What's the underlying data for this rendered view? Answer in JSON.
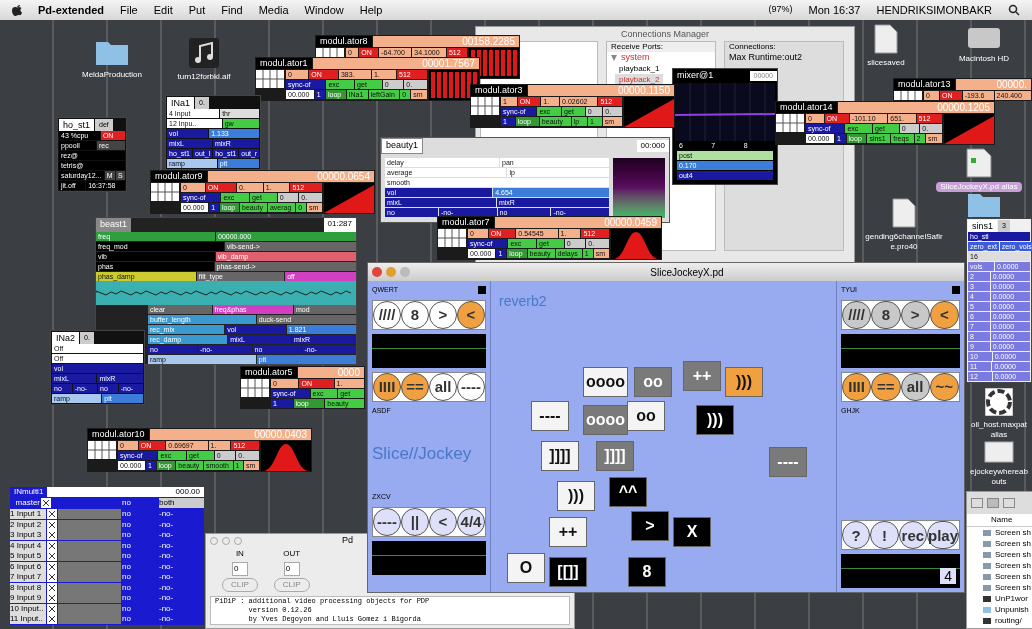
{
  "menubar": {
    "app": "Pd-extended",
    "menus": [
      "File",
      "Edit",
      "Put",
      "Find",
      "Media",
      "Window",
      "Help"
    ],
    "battery": "(97%)",
    "clock": "Mon 16:37",
    "user": "HENDRIKSIMONBAKR"
  },
  "desktop_icons": [
    {
      "kind": "folder",
      "label": "MeldaProduction"
    },
    {
      "kind": "music",
      "label": "turn12forbkl.aif"
    },
    {
      "kind": "file",
      "label": "slicesaved"
    },
    {
      "kind": "disk",
      "label": "Macintosh HD"
    },
    {
      "kind": "pd",
      "label": "SliceJockeyX.pd alias"
    },
    {
      "kind": "file",
      "label": "gending6channelSafire.pro40"
    },
    {
      "kind": "folder"
    },
    {
      "kind": "app",
      "label": "oll_host.maxpat alias"
    },
    {
      "kind": "screen",
      "label": "ejockeywhereabouts"
    }
  ],
  "connections_manager": {
    "title": "Connections Manager",
    "receive_label": "Receive Ports:",
    "tree": {
      "label": "system",
      "expanded": true,
      "children": [
        {
          "label": "playback_1",
          "selected": false
        },
        {
          "label": "playback_2",
          "selected": true
        }
      ]
    },
    "connections_label": "Connections:",
    "connections": [
      "Max Runtime:out2"
    ]
  },
  "patches": [
    {
      "kind": "beauty",
      "title": "beauty1",
      "value": "00:000",
      "lines": [
        [
          {
            "text": "delay",
            "color": "#ffffff"
          },
          {
            "text": "pan",
            "color": "#ffffff"
          }
        ],
        [
          {
            "text": "average",
            "color": "#ffffff"
          },
          {
            "text": "lp",
            "color": "#ffffff"
          }
        ],
        [
          {
            "text": "smooth",
            "color": "#ffffff"
          }
        ],
        [
          {
            "text": "vol",
            "color": "#1a1aa0"
          },
          {
            "text": "4.654",
            "color": "#3b7dd8"
          }
        ],
        [
          {
            "text": "mixL",
            "color": "#1a1aa0"
          },
          {
            "text": "mixR",
            "color": "#1a1aa0"
          }
        ],
        [
          {
            "text": "no",
            "color": "#1a1aa0"
          },
          {
            "text": "-no-",
            "color": "#1a1aa0"
          },
          {
            "text": "no",
            "color": "#1a1aa0"
          },
          {
            "text": "-no-",
            "color": "#1a1aa0"
          }
        ]
      ]
    },
    {
      "kind": "mixer",
      "title": "mixer@1",
      "value": "00000",
      "lines": [
        [
          {
            "text": "6",
            "color": "#000000"
          },
          {
            "text": "7",
            "color": "#000000"
          },
          {
            "text": "8",
            "color": "#000000"
          }
        ],
        [
          {
            "text": "post",
            "color": "#aee0a0"
          }
        ],
        [
          {
            "text": "0.170",
            "color": "#3b7dd8"
          }
        ],
        [
          {
            "text": "out4",
            "color": "#1a1aa0"
          }
        ]
      ]
    },
    {
      "kind": "modulator",
      "title": "modul.ator8",
      "value": "00158.2285",
      "graph": {
        "kind": "bars"
      },
      "lines": [
        [
          {
            "text": "0",
            "color": "#f4b08a"
          },
          {
            "text": "ON",
            "color": "#e02020"
          },
          {
            "text": "-64.700",
            "color": "#f4b08a"
          },
          {
            "text": "34.1000",
            "color": "#f4b08a"
          },
          {
            "text": "512",
            "color": "#e02020"
          }
        ]
      ]
    },
    {
      "kind": "modulator",
      "title": "modul.ator1",
      "value": "00001.7567",
      "graph": {
        "kind": "bars"
      },
      "lines": [
        [
          {
            "text": "0",
            "color": "#f4b08a"
          },
          {
            "text": "ON",
            "color": "#e02020"
          },
          {
            "text": "383.",
            "color": "#f4b08a"
          },
          {
            "text": "1.",
            "color": "#f4b08a"
          },
          {
            "text": "512",
            "color": "#e02020"
          }
        ],
        [
          {
            "text": "sync-of",
            "color": "#1a1aa0"
          },
          {
            "text": "exc",
            "color": "#44cc44"
          },
          {
            "text": "get",
            "color": "#44cc44"
          },
          {
            "text": "0",
            "color": "#cccccc"
          },
          {
            "text": "0.",
            "color": "#cccccc"
          }
        ],
        [
          {
            "text": "00.000",
            "color": "#ffffff"
          },
          {
            "text": "1",
            "color": "#1a1aa0"
          },
          {
            "text": "loop",
            "color": "#339933"
          },
          {
            "text": "INa1",
            "color": "#44cc44"
          },
          {
            "text": "leftGain",
            "color": "#44cc44"
          },
          {
            "text": "0",
            "color": "#44cc44"
          },
          {
            "text": "sm",
            "color": "#f4b08a"
          }
        ]
      ]
    },
    {
      "kind": "modulator",
      "title": "modul.ator3",
      "value": "00000.1150",
      "graph": {
        "kind": "ramp"
      },
      "lines": [
        [
          {
            "text": "1",
            "color": "#f4b08a"
          },
          {
            "text": "ON",
            "color": "#e02020"
          },
          {
            "text": "1.",
            "color": "#f4b08a"
          },
          {
            "text": "0.02602",
            "color": "#f4b08a"
          },
          {
            "text": "512",
            "color": "#e02020"
          }
        ],
        [
          {
            "text": "sync-of",
            "color": "#1a1aa0"
          },
          {
            "text": "exc",
            "color": "#44cc44"
          },
          {
            "text": "get",
            "color": "#44cc44"
          },
          {
            "text": "0",
            "color": "#cccccc"
          },
          {
            "text": "0.",
            "color": "#cccccc"
          }
        ],
        [
          {
            "text": "1",
            "color": "#1a1aa0"
          },
          {
            "text": "loop",
            "color": "#339933"
          },
          {
            "text": "beauty",
            "color": "#44cc44"
          },
          {
            "text": "lp",
            "color": "#44cc44"
          },
          {
            "text": "1",
            "color": "#44cc44"
          },
          {
            "text": "sm",
            "color": "#f4b08a"
          }
        ]
      ]
    },
    {
      "kind": "modulator",
      "title": "modul.ator13",
      "value": "00000.",
      "lines": [
        [
          {
            "text": "0",
            "color": "#f4b08a"
          },
          {
            "text": "ON",
            "color": "#e02020"
          },
          {
            "text": "-193.6",
            "color": "#f4b08a"
          },
          {
            "text": "240.400",
            "color": "#f4b08a"
          }
        ]
      ]
    },
    {
      "kind": "modulator",
      "title": "modul.ator14",
      "value": "00000.1205",
      "graph": {
        "kind": "ramp"
      },
      "lines": [
        [
          {
            "text": "0",
            "color": "#f4b08a"
          },
          {
            "text": "ON",
            "color": "#e02020"
          },
          {
            "text": "-101.10",
            "color": "#f4b08a"
          },
          {
            "text": "651.",
            "color": "#f4b08a"
          },
          {
            "text": "512",
            "color": "#e02020"
          }
        ],
        [
          {
            "text": "sync-of",
            "color": "#1a1aa0"
          },
          {
            "text": "exc",
            "color": "#44cc44"
          },
          {
            "text": "get",
            "color": "#44cc44"
          },
          {
            "text": "0",
            "color": "#cccccc"
          },
          {
            "text": "0.",
            "color": "#cccccc"
          }
        ],
        [
          {
            "text": "00.000",
            "color": "#ffffff"
          },
          {
            "text": "1",
            "color": "#1a1aa0"
          },
          {
            "text": "loop",
            "color": "#339933"
          },
          {
            "text": "sins1",
            "color": "#44cc44"
          },
          {
            "text": "freqs",
            "color": "#44cc44"
          },
          {
            "text": "2",
            "color": "#44cc44"
          },
          {
            "text": "sm",
            "color": "#f4b08a"
          }
        ]
      ]
    },
    {
      "kind": "modulator",
      "title": "modul.ator9",
      "value": "00000.0654",
      "graph": {
        "kind": "ramp"
      },
      "lines": [
        [
          {
            "text": "0",
            "color": "#f4b08a"
          },
          {
            "text": "ON",
            "color": "#e02020"
          },
          {
            "text": "0.",
            "color": "#f4b08a"
          },
          {
            "text": "1.",
            "color": "#f4b08a"
          },
          {
            "text": "512",
            "color": "#e02020"
          }
        ],
        [
          {
            "text": "sync-of",
            "color": "#1a1aa0"
          },
          {
            "text": "exc",
            "color": "#44cc44"
          },
          {
            "text": "get",
            "color": "#44cc44"
          },
          {
            "text": "0",
            "color": "#cccccc"
          },
          {
            "text": "0.",
            "color": "#cccccc"
          }
        ],
        [
          {
            "text": "00.000",
            "color": "#ffffff"
          },
          {
            "text": "1",
            "color": "#1a1aa0"
          },
          {
            "text": "loop",
            "color": "#339933"
          },
          {
            "text": "beauty",
            "color": "#44cc44"
          },
          {
            "text": "averag",
            "color": "#44cc44"
          },
          {
            "text": "0",
            "color": "#44cc44"
          },
          {
            "text": "sm",
            "color": "#f4b08a"
          }
        ]
      ]
    },
    {
      "kind": "modulator",
      "title": "modul.ator7",
      "value": "00000.0459",
      "graph": {
        "kind": "bell"
      },
      "lines": [
        [
          {
            "text": "0",
            "color": "#f4b08a"
          },
          {
            "text": "ON",
            "color": "#e02020"
          },
          {
            "text": "0.54545",
            "color": "#f4b08a"
          },
          {
            "text": "1.",
            "color": "#f4b08a"
          },
          {
            "text": "512",
            "color": "#e02020"
          }
        ],
        [
          {
            "text": "sync-of",
            "color": "#1a1aa0"
          },
          {
            "text": "exc",
            "color": "#44cc44"
          },
          {
            "text": "get",
            "color": "#44cc44"
          },
          {
            "text": "0",
            "color": "#cccccc"
          },
          {
            "text": "0.",
            "color": "#cccccc"
          }
        ],
        [
          {
            "text": "00.000",
            "color": "#ffffff"
          },
          {
            "text": "1",
            "color": "#1a1aa0"
          },
          {
            "text": "loop",
            "color": "#339933"
          },
          {
            "text": "beauty",
            "color": "#44cc44"
          },
          {
            "text": "delays",
            "color": "#44cc44"
          },
          {
            "text": "1",
            "color": "#44cc44"
          },
          {
            "text": "sm",
            "color": "#f4b08a"
          }
        ]
      ]
    },
    {
      "kind": "modulator",
      "title": "modul.ator5",
      "value": "0000",
      "lines": [
        [
          {
            "text": "0",
            "color": "#f4b08a"
          },
          {
            "text": "ON",
            "color": "#e02020"
          },
          {
            "text": "1.",
            "color": "#f4b08a"
          }
        ],
        [
          {
            "text": "sync-of",
            "color": "#1a1aa0"
          },
          {
            "text": "exc",
            "color": "#44cc44"
          },
          {
            "text": "get",
            "color": "#44cc44"
          }
        ],
        [
          {
            "text": "1",
            "color": "#1a1aa0"
          },
          {
            "text": "loop",
            "color": "#339933"
          },
          {
            "text": "beauty",
            "color": "#44cc44"
          }
        ]
      ]
    },
    {
      "kind": "modulator",
      "title": "modul.ator10",
      "value": "00000.0403",
      "graph": {
        "kind": "bell"
      },
      "lines": [
        [
          {
            "text": "0",
            "color": "#f4b08a"
          },
          {
            "text": "ON",
            "color": "#e02020"
          },
          {
            "text": "0.69697",
            "color": "#f4b08a"
          },
          {
            "text": "1.",
            "color": "#f4b08a"
          },
          {
            "text": "512",
            "color": "#e02020"
          }
        ],
        [
          {
            "text": "sync-of",
            "color": "#1a1aa0"
          },
          {
            "text": "exc",
            "color": "#44cc44"
          },
          {
            "text": "get",
            "color": "#44cc44"
          },
          {
            "text": "0",
            "color": "#cccccc"
          },
          {
            "text": "0.",
            "color": "#cccccc"
          }
        ],
        [
          {
            "text": "00.000",
            "color": "#ffffff"
          },
          {
            "text": "1",
            "color": "#1a1aa0"
          },
          {
            "text": "loop",
            "color": "#339933"
          },
          {
            "text": "beauty",
            "color": "#44cc44"
          },
          {
            "text": "smooth",
            "color": "#44cc44"
          },
          {
            "text": "1",
            "color": "#44cc44"
          },
          {
            "text": "sm",
            "color": "#f4b08a"
          }
        ]
      ]
    },
    {
      "kind": "panel",
      "title": "ho_st1",
      "value": "def",
      "lines": [
        [
          {
            "text": "43 %cpu",
            "color": "#000000"
          },
          {
            "text": "ON",
            "color": "#e02020"
          }
        ],
        [
          {
            "text": "ppooll",
            "color": "#000000"
          },
          {
            "text": "rec",
            "color": "#444444"
          }
        ],
        [
          {
            "text": "rez@",
            "color": "#000000"
          }
        ],
        [
          {
            "text": "tetris@",
            "color": "#000000"
          }
        ],
        [
          {
            "text": "saturday12...",
            "color": "#000000"
          },
          {
            "text": "M",
            "color": "#444444"
          },
          {
            "text": "S",
            "color": "#444444"
          }
        ],
        [
          {
            "text": "jit.off",
            "color": "#000000"
          },
          {
            "text": "16:37:58",
            "color": "#000000"
          }
        ]
      ]
    },
    {
      "kind": "panel",
      "title": "INa1",
      "value": "0.",
      "lines": [
        [
          {
            "text": "4 Input",
            "color": "#ffffff"
          },
          {
            "text": "thr",
            "color": "#dddddd"
          }
        ],
        [
          {
            "text": "12 Inpu..",
            "color": "#ffffff"
          },
          {
            "text": "gw",
            "color": "#44cc44"
          }
        ],
        [
          {
            "text": "vol",
            "color": "#1a1aa0"
          },
          {
            "text": "1.133",
            "color": "#3b7dd8"
          }
        ],
        [
          {
            "text": "mixL",
            "color": "#1a1aa0"
          },
          {
            "text": "mixR",
            "color": "#1a1aa0"
          }
        ],
        [
          {
            "text": "ho_st1",
            "color": "#1a1aa0"
          },
          {
            "text": "out_l",
            "color": "#1a1aa0"
          },
          {
            "text": "ho_st1",
            "color": "#1a1aa0"
          },
          {
            "text": "out_r",
            "color": "#1a1aa0"
          }
        ],
        [
          {
            "text": "ramp",
            "color": "#a8c8f0"
          },
          {
            "text": "pit",
            "color": "#3b7dd8"
          }
        ]
      ]
    },
    {
      "kind": "beast",
      "title": "beast1",
      "value": "01:287",
      "lines": [
        [
          {
            "text": "freq",
            "color": "#2e9e3e"
          },
          {
            "text": "00000.000",
            "color": "#2e9e3e"
          }
        ],
        [
          {
            "text": "freq_mod",
            "color": "#000000"
          },
          {
            "text": "vib-send->",
            "color": "#666666"
          }
        ],
        [
          {
            "text": "vib",
            "color": "#000000"
          },
          {
            "text": "vib_damp",
            "color": "#e06070"
          }
        ],
        [
          {
            "text": "phas",
            "color": "#000000"
          },
          {
            "text": "phas-send->",
            "color": "#666666"
          }
        ],
        [
          {
            "text": "phas_damp",
            "color": "#cccc30"
          },
          {
            "text": "filt_type",
            "color": "#666666"
          },
          {
            "text": "off",
            "color": "#d040c0"
          }
        ],
        [
          {
            "text": "clear",
            "color": "#666666"
          },
          {
            "text": "freq&phas",
            "color": "#d040c0"
          },
          {
            "text": "mod",
            "color": "#666666"
          }
        ],
        [
          {
            "text": "buffer_length",
            "color": "#3a9ad0"
          },
          {
            "text": "duck-send",
            "color": "#666666"
          }
        ],
        [
          {
            "text": "rec_mix",
            "color": "#3a9ad0"
          },
          {
            "text": "vol",
            "color": "#1a1aa0"
          },
          {
            "text": "1.821",
            "color": "#3b7dd8"
          }
        ],
        [
          {
            "text": "rec_damp",
            "color": "#3a9ad0"
          },
          {
            "text": "mixL",
            "color": "#1a1aa0"
          },
          {
            "text": "mixR",
            "color": "#1a1aa0"
          }
        ],
        [
          {
            "text": "no",
            "color": "#1a1aa0"
          },
          {
            "text": "-no-",
            "color": "#1a1aa0"
          },
          {
            "text": "no",
            "color": "#1a1aa0"
          },
          {
            "text": "-no-",
            "color": "#1a1aa0"
          }
        ],
        [
          {
            "text": "ramp",
            "color": "#a8c8f0"
          },
          {
            "text": "pit",
            "color": "#3b7dd8"
          }
        ]
      ]
    },
    {
      "kind": "panel",
      "title": "INa2",
      "value": "0.",
      "lines": [
        [
          {
            "text": "Off",
            "color": "#ffffff"
          }
        ],
        [
          {
            "text": "Off",
            "color": "#ffffff"
          }
        ],
        [
          {
            "text": "vol",
            "color": "#1a1aa0"
          }
        ],
        [
          {
            "text": "mixL",
            "color": "#1a1aa0"
          },
          {
            "text": "mixR",
            "color": "#1a1aa0"
          }
        ],
        [
          {
            "text": "no",
            "color": "#1a1aa0"
          },
          {
            "text": "-no-",
            "color": "#1a1aa0"
          },
          {
            "text": "no",
            "color": "#1a1aa0"
          },
          {
            "text": "-no-",
            "color": "#1a1aa0"
          }
        ],
        [
          {
            "text": "ramp",
            "color": "#a8c8f0"
          },
          {
            "text": "pit",
            "color": "#3b7dd8"
          }
        ]
      ]
    },
    {
      "kind": "sins",
      "title": "sins1",
      "value": "3",
      "lines": [
        [
          {
            "text": "ho_stl",
            "color": "#1a1aa0"
          }
        ],
        [
          {
            "text": "zero_ext",
            "color": "#3b5bd8"
          },
          {
            "text": "zero_vols",
            "color": "#3b5bd8"
          }
        ],
        [
          {
            "text": "16",
            "color": "#dddddd"
          }
        ],
        [
          {
            "text": "vols",
            "color": "#7a7ae0"
          },
          {
            "text": "0.0000",
            "color": "#7a7ae0"
          }
        ],
        [
          {
            "text": "2",
            "color": "#7a7ae0"
          },
          {
            "text": "0.0000",
            "color": "#7a7ae0"
          }
        ],
        [
          {
            "text": "3",
            "color": "#7a7ae0"
          },
          {
            "text": "0.0000",
            "color": "#7a7ae0"
          }
        ],
        [
          {
            "text": "4",
            "color": "#7a7ae0"
          },
          {
            "text": "0.0000",
            "color": "#7a7ae0"
          }
        ],
        [
          {
            "text": "5",
            "color": "#7a7ae0"
          },
          {
            "text": "0.0000",
            "color": "#7a7ae0"
          }
        ],
        [
          {
            "text": "6",
            "color": "#7a7ae0"
          },
          {
            "text": "0.0000",
            "color": "#7a7ae0"
          }
        ],
        [
          {
            "text": "7",
            "color": "#7a7ae0"
          },
          {
            "text": "0.0000",
            "color": "#7a7ae0"
          }
        ],
        [
          {
            "text": "8",
            "color": "#7a7ae0"
          },
          {
            "text": "0.0000",
            "color": "#7a7ae0"
          }
        ],
        [
          {
            "text": "9",
            "color": "#7a7ae0"
          },
          {
            "text": "0.0000",
            "color": "#7a7ae0"
          }
        ],
        [
          {
            "text": "10",
            "color": "#7a7ae0"
          },
          {
            "text": "0.0000",
            "color": "#7a7ae0"
          }
        ],
        [
          {
            "text": "11",
            "color": "#7a7ae0"
          },
          {
            "text": "0.0000",
            "color": "#7a7ae0"
          }
        ],
        [
          {
            "text": "12",
            "color": "#7a7ae0"
          },
          {
            "text": "0.0000",
            "color": "#7a7ae0"
          }
        ]
      ]
    }
  ],
  "inmulti": {
    "title": "INmulti1",
    "value": "000.00",
    "master": {
      "label": "master",
      "route": "no",
      "mode": "both"
    },
    "inputs": [
      {
        "label": "1 Input 1",
        "route": "no",
        "send": "-no-"
      },
      {
        "label": "2 Input 2",
        "route": "no",
        "send": "-no-"
      },
      {
        "label": "3 Input 3",
        "route": "no",
        "send": "-no-"
      },
      {
        "label": "4 Input 4",
        "route": "no",
        "send": "-no-"
      },
      {
        "label": "5 Input 5",
        "route": "no",
        "send": "-no-"
      },
      {
        "label": "6 Input 6",
        "route": "no",
        "send": "-no-"
      },
      {
        "label": "7 Input 7",
        "route": "no",
        "send": "-no-"
      },
      {
        "label": "8 Input 8",
        "route": "no",
        "send": "-no-"
      },
      {
        "label": "9 Input 9",
        "route": "no",
        "send": "-no-"
      },
      {
        "label": "10 Input..",
        "route": "no",
        "send": "-no-"
      },
      {
        "label": "11 Input..",
        "route": "no",
        "send": "-no-"
      }
    ]
  },
  "pd_window": {
    "title": "Pd",
    "in_label": "IN",
    "out_label": "OUT",
    "in_value": "0",
    "out_value": "0",
    "clip_buttons": [
      "CLIP",
      "CLIP"
    ],
    "console": [
      "PiDiP : additional video processing objects for PDP",
      "        version 0.12.26",
      "        by Yves Degoyon and Lluis Gomez i Bigorda"
    ]
  },
  "finder": {
    "column": "Name",
    "items": [
      {
        "kind": "image",
        "label": "Screen sh"
      },
      {
        "kind": "image",
        "label": "Screen sh"
      },
      {
        "kind": "image",
        "label": "Screen sh"
      },
      {
        "kind": "image",
        "label": "Screen sh"
      },
      {
        "kind": "image",
        "label": "Screen sh"
      },
      {
        "kind": "image",
        "label": "Screen sh"
      },
      {
        "kind": "doc",
        "label": "UnP1wor"
      },
      {
        "kind": "folder",
        "label": "Unpunish"
      },
      {
        "kind": "doc",
        "label": "routing/"
      }
    ]
  },
  "slicejockey": {
    "title": "SliceJockeyX.pd",
    "left": {
      "top_label": "QWERT",
      "row1": [
        {
          "label": "////",
          "color": "#ffffff"
        },
        {
          "label": "8",
          "color": "#ffffff"
        },
        {
          "label": ">",
          "color": "#ffffff"
        },
        {
          "label": "<",
          "color": "#f0a040"
        }
      ],
      "row2": [
        {
          "label": "IIII",
          "color": "#f0a040"
        },
        {
          "label": "==",
          "color": "#f0a040"
        },
        {
          "label": "all",
          "color": "#ffffff"
        },
        {
          "label": "----",
          "color": "#ffffff"
        }
      ],
      "mid_label": "ASDF",
      "brand": "Slice//Jockey",
      "bottom_label": "ZXCV",
      "row3": [
        {
          "label": "----",
          "color": "#dde0f8"
        },
        {
          "label": "||",
          "color": "#dde0f8"
        },
        {
          "label": "<",
          "color": "#dde0f8"
        },
        {
          "label": "4/4",
          "color": "#dde0f8"
        }
      ]
    },
    "center": {
      "title": "reverb2",
      "tiles": [
        {
          "label": "oooo",
          "color": "#f4f4f4"
        },
        {
          "label": "oo",
          "color": "#7a7a7a"
        },
        {
          "label": "++",
          "color": "#7a7a7a"
        },
        {
          "label": ")))",
          "color": "#f0a040"
        },
        {
          "label": "----",
          "color": "#f4f4f4"
        },
        {
          "label": "oooo",
          "color": "#7a7a7a"
        },
        {
          "label": "oo",
          "color": "#f4f4f4"
        },
        {
          "label": ")))",
          "color": "#000000"
        },
        {
          "label": "]]]]",
          "color": "#f4f4f4"
        },
        {
          "label": "]]]]",
          "color": "#7a7a7a"
        },
        {
          "label": "----",
          "color": "#7a7a7a"
        },
        {
          "label": ")))",
          "color": "#f4f4f4"
        },
        {
          "label": "^^",
          "color": "#000000"
        },
        {
          "label": "++",
          "color": "#f4f4f4"
        },
        {
          "label": ">",
          "color": "#000000"
        },
        {
          "label": "X",
          "color": "#000000"
        },
        {
          "label": "O",
          "color": "#f4f4f4"
        },
        {
          "label": "[[]]",
          "color": "#000000"
        },
        {
          "label": "8",
          "color": "#000000"
        }
      ]
    },
    "right": {
      "top_label": "TYUI",
      "row1": [
        {
          "label": "////",
          "color": "#c8c8c8"
        },
        {
          "label": "8",
          "color": "#c8c8c8"
        },
        {
          "label": ">",
          "color": "#c8c8c8"
        },
        {
          "label": "<",
          "color": "#f0a040"
        }
      ],
      "row2": [
        {
          "label": "IIII",
          "color": "#f0a040"
        },
        {
          "label": "==",
          "color": "#f0a040"
        },
        {
          "label": "all",
          "color": "#c8c8c8"
        },
        {
          "label": "~~",
          "color": "#f0a040"
        }
      ],
      "mid_label": "GHJK",
      "row3": [
        {
          "label": "?",
          "color": "#dde0f8"
        },
        {
          "label": "!",
          "color": "#dde0f8"
        },
        {
          "label": "rec",
          "color": "#dde0f8"
        },
        {
          "label": "play",
          "color": "#dde0f8"
        }
      ],
      "counter": "4"
    }
  }
}
